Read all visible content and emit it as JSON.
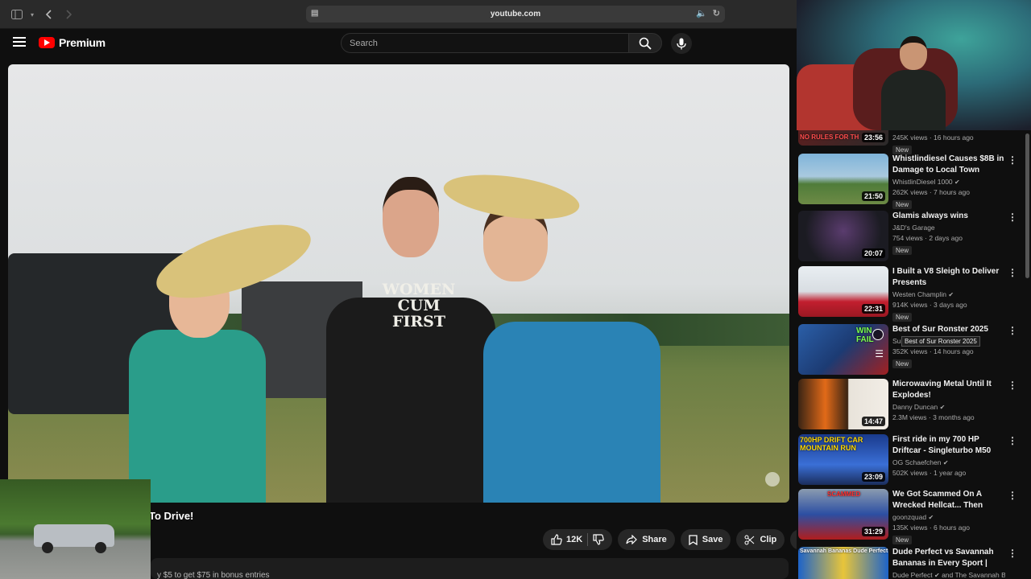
{
  "browser": {
    "url": "youtube.com"
  },
  "header": {
    "logo_text": "Premium",
    "search_placeholder": "Search"
  },
  "video": {
    "title": "To Drive!",
    "shirt_text": "WOMEN CUM FIRST",
    "likes": "12K",
    "share_label": "Share",
    "save_label": "Save",
    "clip_label": "Clip",
    "more_label": "...",
    "description_snippet": "y $5 to get $75 in bonus entries"
  },
  "sidebar": {
    "top_partial": {
      "meta": "245K views · 16 hours ago",
      "badge": "New",
      "duration": "23:56",
      "thumb_text": "NO RULES FOR TH"
    },
    "tooltip": "Best of Sur Ronster 2025",
    "items": [
      {
        "title": "Whistlindiesel Causes $8B in Damage to Local Town",
        "channel": "WhistlinDiesel 1000",
        "verified": true,
        "meta": "262K views · 7 hours ago",
        "badge": "New",
        "duration": "21:50"
      },
      {
        "title": "Glamis always wins",
        "channel": "J&D's Garage",
        "verified": false,
        "meta": "754 views · 2 days ago",
        "badge": "New",
        "duration": "20:07"
      },
      {
        "title": "I Built a V8 Sleigh to Deliver Presents",
        "channel": "Westen Champlin",
        "verified": true,
        "meta": "914K views · 3 days ago",
        "badge": "New",
        "duration": "22:31"
      },
      {
        "title": "Best of Sur Ronster 2025",
        "channel": "Su",
        "verified": false,
        "meta": "352K views · 14 hours ago",
        "badge": "New",
        "duration": "",
        "thumb_text": "WIN FAIL"
      },
      {
        "title": "Microwaving Metal Until It Explodes!",
        "channel": "Danny Duncan",
        "verified": true,
        "meta": "2.3M views · 3 months ago",
        "badge": "",
        "duration": "14:47"
      },
      {
        "title": "First ride in my 700 HP Driftcar - Singleturbo M50 E36 goes cra...",
        "channel": "OG Schaefchen",
        "verified": true,
        "meta": "502K views · 1 year ago",
        "badge": "",
        "duration": "23:09",
        "thumb_text": "700HP DRIFT CAR MOUNTAIN RUN"
      },
      {
        "title": "We Got Scammed On A Wrecked Hellcat... Then Fixed ...",
        "channel": "goonzquad",
        "verified": true,
        "meta": "135K views · 6 hours ago",
        "badge": "New",
        "duration": "31:29",
        "thumb_text": "SCAMMED"
      },
      {
        "title": "Dude Perfect vs Savannah Bananas in Every Sport | Squa...",
        "channel": "Dude Perfect",
        "verified": true,
        "meta": "and The Savannah Ban...",
        "badge": "",
        "duration": "",
        "thumb_text": "Savannah Bananas  Dude Perfect"
      }
    ]
  }
}
